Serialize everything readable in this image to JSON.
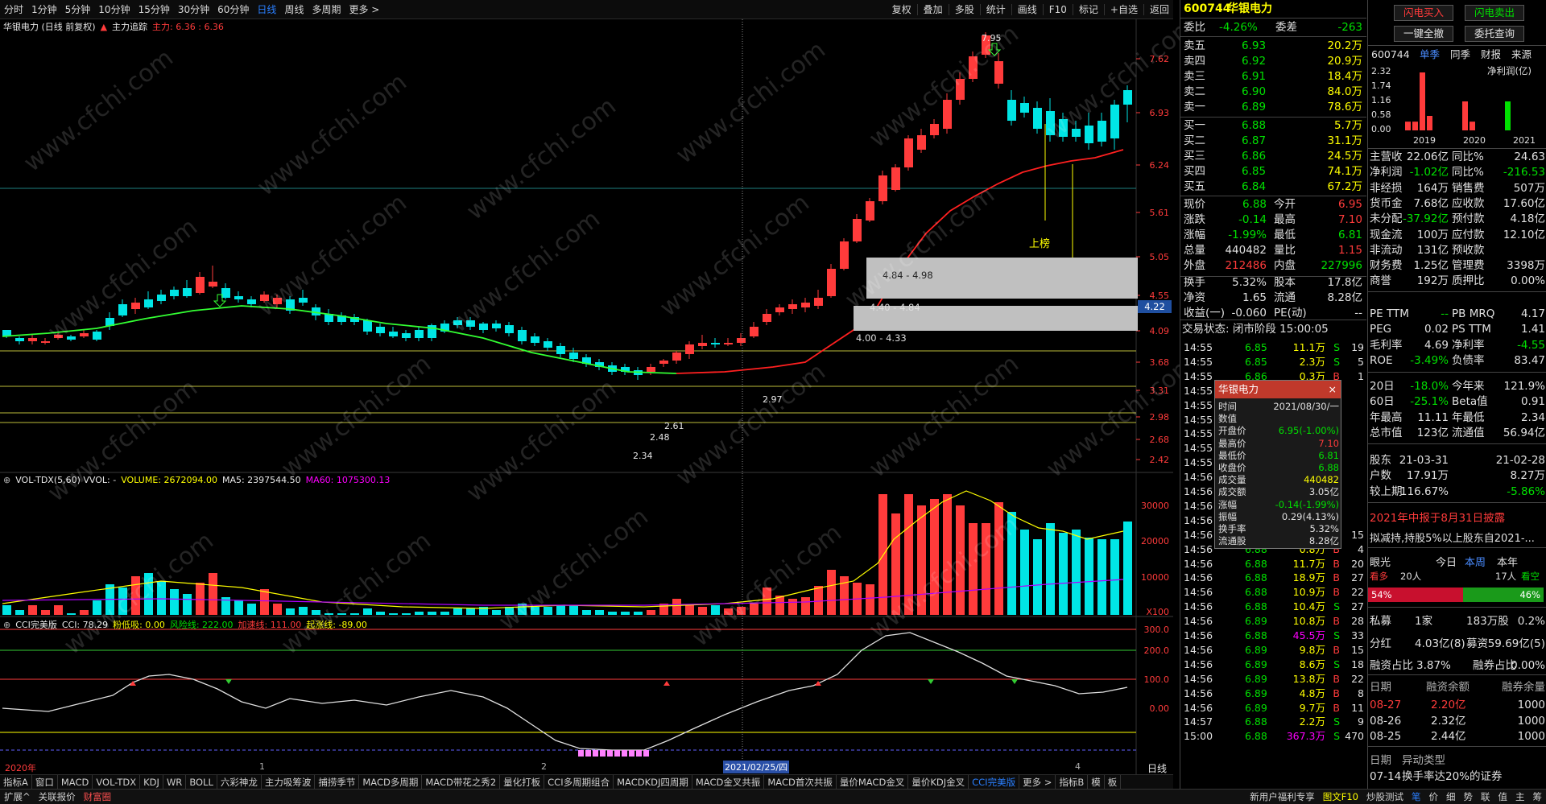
{
  "toolbar": {
    "left": [
      "分时",
      "1分钟",
      "5分钟",
      "10分钟",
      "15分钟",
      "30分钟",
      "60分钟",
      "日线",
      "周线",
      "多周期",
      "更多 >"
    ],
    "active": "日线",
    "right": [
      "复权",
      "叠加",
      "多股",
      "统计",
      "画线",
      "F10",
      "标记",
      "+自选",
      "返回"
    ]
  },
  "chart_title": {
    "name": "华银电力 (日线 前复权)",
    "indicator": "主力追踪",
    "value": "主力: 6.36 : 6.36"
  },
  "price_axis": [
    "7.62",
    "6.93",
    "6.24",
    "5.61",
    "5.05",
    "4.55",
    "4.09",
    "3.68",
    "3.31",
    "2.98",
    "2.68",
    "2.42"
  ],
  "price_tag": "4.22",
  "price_labels": {
    "high": "7.95",
    "low": "2.34",
    "p297": "2.97",
    "p261": "2.61",
    "p248": "2.48"
  },
  "zones": [
    "4.84 - 4.98",
    "4.40 - 4.84",
    "4.00 - 4.33"
  ],
  "annotations": {
    "shangbang": "上榜",
    "mairu": "买入"
  },
  "vol_title": {
    "name": "VOL-TDX(5,60) VVOL: -",
    "volume": "VOLUME: 2672094.00",
    "ma5": "MA5: 2397544.50",
    "ma60": "MA60: 1075300.13"
  },
  "vol_axis": [
    "30000",
    "20000",
    "10000",
    "X100"
  ],
  "cci_title": {
    "name": "CCI完美版",
    "cci": "CCI: 78.29",
    "fen": "粉低吸: 0.00",
    "feng": "风险线: 222.00",
    "jia": "加速线: 111.00",
    "qi": "起涨线: -89.00"
  },
  "cci_axis": [
    "300.0",
    "200.0",
    "100.0",
    "0.00"
  ],
  "date_axis": {
    "y2020": "2020年",
    "m1": "1",
    "m2": "2",
    "date": "2021/02/25/四",
    "m4": "4",
    "label": "日线"
  },
  "bottom_tabs": [
    "指标A",
    "窗口",
    "MACD",
    "VOL-TDX",
    "KDJ",
    "WR",
    "BOLL",
    "六彩神龙",
    "主力吸筹波",
    "捕捞季节",
    "MACD多周期",
    "MACD带花之秀2",
    "量化打板",
    "CCI多周期组合",
    "MACDKDJ四周期",
    "MACD金叉共振",
    "MACD首次共振",
    "量价MACD金叉",
    "量价KDJ金叉",
    "CCI完美版",
    "更多 >",
    "指标B",
    "模",
    "板"
  ],
  "bottom_active": "CCI完美版",
  "status": {
    "left": [
      "扩展^",
      "关联报价",
      "财富圈"
    ],
    "right": [
      "新用户福利专享",
      "图文F10",
      "炒股测试",
      "笔",
      "价",
      "细",
      "势",
      "联",
      "值",
      "主",
      "筹"
    ]
  },
  "quote": {
    "code": "600744",
    "name": "华银电力",
    "wb_label": "委比",
    "wb": "-4.26%",
    "wc_label": "委差",
    "wc": "-263",
    "sells": [
      [
        "卖五",
        "6.93",
        "20.2万"
      ],
      [
        "卖四",
        "6.92",
        "20.9万"
      ],
      [
        "卖三",
        "6.91",
        "18.4万"
      ],
      [
        "卖二",
        "6.90",
        "84.0万"
      ],
      [
        "卖一",
        "6.89",
        "78.6万"
      ]
    ],
    "buys": [
      [
        "买一",
        "6.88",
        "5.7万"
      ],
      [
        "买二",
        "6.87",
        "31.1万"
      ],
      [
        "买三",
        "6.86",
        "24.5万"
      ],
      [
        "买四",
        "6.85",
        "74.1万"
      ],
      [
        "买五",
        "6.84",
        "67.2万"
      ]
    ],
    "stats": [
      [
        "现价",
        "6.88",
        "今开",
        "6.95"
      ],
      [
        "涨跌",
        "-0.14",
        "最高",
        "7.10"
      ],
      [
        "涨幅",
        "-1.99%",
        "最低",
        "6.81"
      ],
      [
        "总量",
        "440482",
        "量比",
        "1.15"
      ],
      [
        "外盘",
        "212486",
        "内盘",
        "227996"
      ],
      [
        "换手",
        "5.32%",
        "股本",
        "17.8亿"
      ],
      [
        "净资",
        "1.65",
        "流通",
        "8.28亿"
      ],
      [
        "收益(一)",
        "-0.060",
        "PE(动)",
        "--"
      ]
    ],
    "trade_status": "交易状态: 闭市阶段 15:00:05",
    "ticks": [
      [
        "14:55",
        "6.85",
        "11.1万",
        "S",
        "19"
      ],
      [
        "14:55",
        "6.85",
        "2.3万",
        "S",
        "5"
      ],
      [
        "14:55",
        "6.86",
        "0.3万",
        "B",
        "1"
      ],
      [
        "14:55",
        "",
        "",
        "",
        ""
      ],
      [
        "14:55",
        "",
        "",
        "",
        ""
      ],
      [
        "14:55",
        "",
        "",
        "",
        ""
      ],
      [
        "14:55",
        "",
        "",
        "",
        ""
      ],
      [
        "14:55",
        "",
        "",
        "",
        ""
      ],
      [
        "14:55",
        "",
        "",
        "",
        ""
      ],
      [
        "14:56",
        "",
        "",
        "",
        ""
      ],
      [
        "14:56",
        "",
        "",
        "",
        ""
      ],
      [
        "14:56",
        "",
        "",
        "",
        ""
      ],
      [
        "14:56",
        "",
        "45.9万",
        "S",
        ""
      ],
      [
        "14:56",
        "6.87",
        "4.2万",
        "S",
        "15"
      ],
      [
        "14:56",
        "6.88",
        "0.8万",
        "B",
        "4"
      ],
      [
        "14:56",
        "6.88",
        "11.7万",
        "B",
        "20"
      ],
      [
        "14:56",
        "6.88",
        "18.9万",
        "B",
        "27"
      ],
      [
        "14:56",
        "6.88",
        "10.9万",
        "B",
        "22"
      ],
      [
        "14:56",
        "6.88",
        "10.4万",
        "S",
        "27"
      ],
      [
        "14:56",
        "6.89",
        "10.8万",
        "B",
        "28"
      ],
      [
        "14:56",
        "6.88",
        "45.5万",
        "S",
        "33"
      ],
      [
        "14:56",
        "6.89",
        "9.8万",
        "B",
        "15"
      ],
      [
        "14:56",
        "6.89",
        "8.6万",
        "S",
        "18"
      ],
      [
        "14:56",
        "6.89",
        "13.8万",
        "B",
        "22"
      ],
      [
        "14:56",
        "6.89",
        "4.8万",
        "B",
        "8"
      ],
      [
        "14:56",
        "6.89",
        "9.7万",
        "B",
        "11"
      ],
      [
        "14:57",
        "6.88",
        "2.2万",
        "S",
        "9"
      ],
      [
        "15:00",
        "6.88",
        "367.3万",
        "S",
        "470"
      ]
    ]
  },
  "tooltip": {
    "title": "华银电力",
    "rows": [
      [
        "时间",
        "2021/08/30/一"
      ],
      [
        "数值",
        ""
      ],
      [
        "开盘价",
        "6.95(-1.00%)"
      ],
      [
        "最高价",
        "7.10"
      ],
      [
        "最低价",
        "6.81"
      ],
      [
        "收盘价",
        "6.88"
      ],
      [
        "成交量",
        "440482"
      ],
      [
        "成交额",
        "3.05亿"
      ],
      [
        "涨幅",
        "-0.14(-1.99%)"
      ],
      [
        "振幅",
        "0.29(4.13%)"
      ],
      [
        "换手率",
        "5.32%"
      ],
      [
        "流通股",
        "8.28亿"
      ]
    ]
  },
  "fin": {
    "btn_flash_buy": "闪电买入",
    "btn_flash_sell": "闪电卖出",
    "btn_cancel_all": "一键全撤",
    "btn_commission": "委托查询",
    "code": "600744",
    "tabs": [
      "单季",
      "同季",
      "财报",
      "来源"
    ],
    "chart_title": "净利润(亿)",
    "y": [
      "2.32",
      "1.74",
      "1.16",
      "0.58",
      "0.00"
    ],
    "years": [
      "2019",
      "2020",
      "2021"
    ],
    "bars": [
      {
        "year": "2019",
        "values": [
          0.35,
          0.35,
          2.32,
          0.58
        ]
      },
      {
        "year": "2020",
        "values": [
          0.0,
          1.16,
          0.35,
          0.0
        ]
      },
      {
        "year": "2021",
        "values": [
          1.16,
          0.0,
          0.0,
          0.0
        ]
      }
    ],
    "rows1": [
      [
        "主营收",
        "22.06亿",
        "同比%",
        "24.63"
      ],
      [
        "净利润",
        "-1.02亿",
        "同比%",
        "-216.53"
      ],
      [
        "非经损",
        "164万",
        "销售费",
        "507万"
      ],
      [
        "货币金",
        "7.68亿",
        "应收款",
        "17.60亿"
      ],
      [
        "未分配",
        "-37.92亿",
        "预付款",
        "4.18亿"
      ],
      [
        "现金流",
        "100万",
        "应付款",
        "12.10亿"
      ],
      [
        "非流动",
        "131亿",
        "预收款",
        ""
      ],
      [
        "财务费",
        "1.25亿",
        "管理费",
        "3398万"
      ],
      [
        "商誉",
        "192万",
        "质押比",
        "0.00%"
      ]
    ],
    "rows2": [
      [
        "PE TTM",
        "--",
        "PB MRQ",
        "4.17"
      ],
      [
        "PEG",
        "0.02",
        "PS TTM",
        "1.41"
      ],
      [
        "毛利率",
        "4.69",
        "净利率",
        "-4.55"
      ],
      [
        "ROE",
        "-3.49%",
        "负债率",
        "83.47"
      ]
    ],
    "rows3": [
      [
        "20日",
        "-18.0%",
        "今年来",
        "121.9%"
      ],
      [
        "60日",
        "-25.1%",
        "Beta值",
        "0.91"
      ],
      [
        "年最高",
        "11.11",
        "年最低",
        "2.34"
      ],
      [
        "总市值",
        "123亿",
        "流通值",
        "56.94亿"
      ]
    ],
    "rows4": [
      [
        "股东",
        "21-03-31",
        "",
        "21-02-28"
      ],
      [
        "户数",
        "17.91万",
        "",
        "8.27万"
      ],
      [
        "较上期",
        "116.67%",
        "",
        "-5.86%"
      ]
    ],
    "notice1": "2021年中报于8月31日披露",
    "notice2": "拟减持,持股5%以上股东自2021-...",
    "vote": {
      "label": "眼光",
      "today": "今日",
      "week": "本周",
      "year": "本年",
      "bull": "看多",
      "bull_n": "20人",
      "bull_n2": "17人",
      "bear": "看空",
      "pct_bull": "54%",
      "pct_bear": "46%",
      "bull_frac": 0.54
    },
    "pf": [
      [
        "私募",
        "1家",
        "183万股",
        "0.2%"
      ],
      [
        "分红",
        "4.03亿(8)",
        "募资",
        "59.69亿(5)"
      ],
      [
        "融资占比",
        "3.87%",
        "融券占比",
        "0.00%"
      ]
    ],
    "margin_head": [
      "日期",
      "融资余额",
      "融券余量"
    ],
    "margin": [
      [
        "08-27",
        "2.20亿",
        "1000"
      ],
      [
        "08-26",
        "2.32亿",
        "1000"
      ],
      [
        "08-25",
        "2.44亿",
        "1000"
      ]
    ],
    "abn_head": [
      "日期",
      "异动类型"
    ],
    "abn": [
      "07-14",
      "换手率达20%的证券"
    ]
  },
  "watermark": "www.cfchi.com",
  "colors": {
    "up": "#ff3b3b",
    "down": "#00e5e5",
    "ma": "#ff2020",
    "vol_ma5": "#ffff00",
    "vol_ma60": "#b000ff",
    "cci": "#e0e0e0"
  },
  "chart_data": {
    "type": "candlestick",
    "series": [
      {
        "name": "主力追踪"
      },
      {
        "name": "MA5"
      },
      {
        "name": "MA60"
      },
      {
        "name": "CCI"
      }
    ]
  }
}
